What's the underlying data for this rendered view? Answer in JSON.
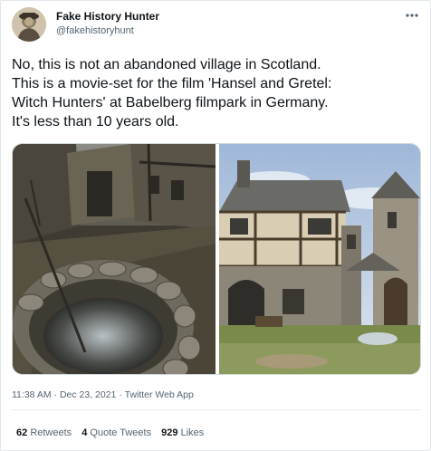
{
  "author": {
    "display_name": "Fake History Hunter",
    "handle": "@fakehistoryhunt"
  },
  "tweet": {
    "text": "No, this is not an abandoned village in Scotland.\nThis is a movie-set for the film 'Hansel and Gretel:\nWitch Hunters' at Babelberg filmpark in Germany.\nIt's less than 10 years old."
  },
  "meta": {
    "time": "11:38 AM",
    "separator": " · ",
    "date": "Dec 23, 2021",
    "source": "Twitter Web App"
  },
  "stats": {
    "retweets_count": "62",
    "retweets_label": "Retweets",
    "quotes_count": "4",
    "quotes_label": "Quote Tweets",
    "likes_count": "929",
    "likes_label": "Likes"
  },
  "icons": {
    "more": "more-dots-icon"
  }
}
